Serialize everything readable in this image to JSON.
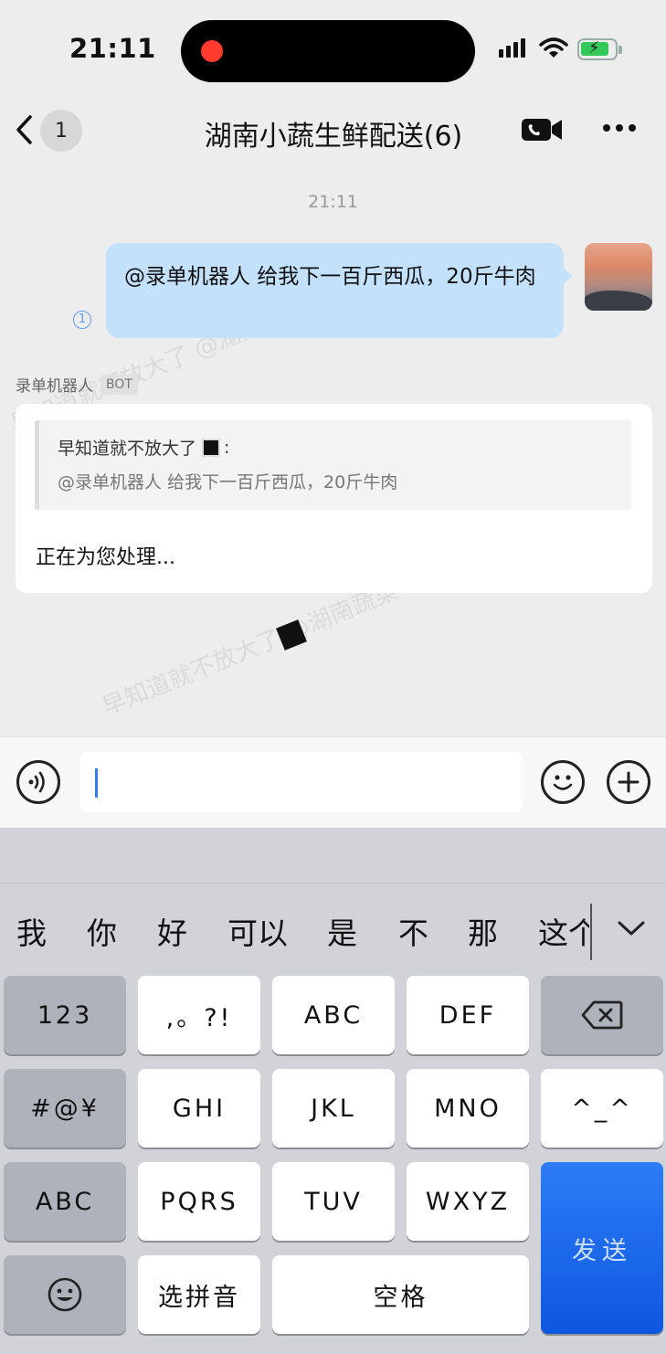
{
  "status_bar": {
    "time": "21:11"
  },
  "header": {
    "unread_count": "1",
    "title": "湖南小蔬生鲜配送(6)"
  },
  "chat": {
    "timestamp": "21:11",
    "outgoing_message": "@录单机器人 给我下一百斤西瓜，20斤牛肉",
    "bot": {
      "name": "录单机器人",
      "badge": "BOT",
      "quote_author": "早知道就不放大了",
      "quote_colon": ":",
      "quote_text": "@录单机器人 给我下一百斤西瓜，20斤牛肉",
      "reply": "正在为您处理..."
    },
    "watermark": "早知道就不放大了 @湖南蔬菜"
  },
  "input": {
    "placeholder": ""
  },
  "keyboard": {
    "candidates": [
      "我",
      "你",
      "好",
      "可以",
      "是",
      "不",
      "那",
      "这个"
    ],
    "keys": {
      "num": "123",
      "punct": ",。?!",
      "abc1": "ABC",
      "def": "DEF",
      "sym": "#@¥",
      "ghi": "GHI",
      "jkl": "JKL",
      "mno": "MNO",
      "emoticon": "^_^",
      "abc2": "ABC",
      "pqrs": "PQRS",
      "tuv": "TUV",
      "wxyz": "WXYZ",
      "send": "发送",
      "pinyin": "选拼音",
      "space": "空格"
    }
  },
  "colors": {
    "outgoing_bubble": "#c4e1fb",
    "send_key": "#0d57e0",
    "accent": "#2f7cf6"
  }
}
